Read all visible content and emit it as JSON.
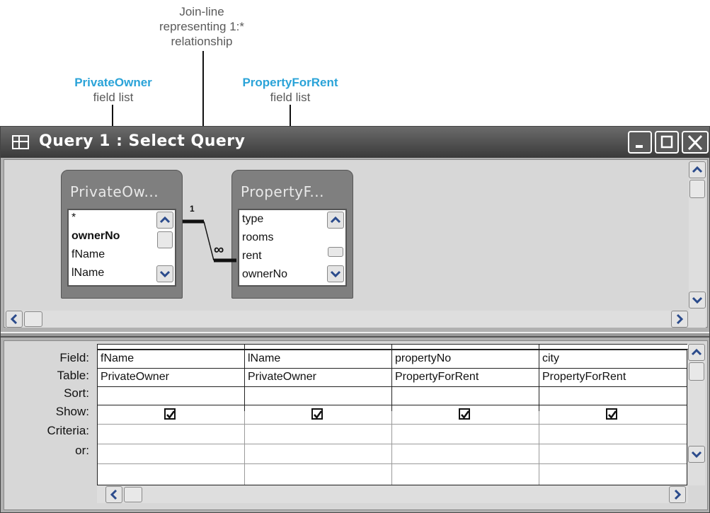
{
  "annotations": {
    "join_line_lines": [
      "Join-line",
      "representing 1:*",
      "relationship"
    ],
    "private_owner_title": "PrivateOwner",
    "private_owner_sub": "field list",
    "property_title": "PropertyForRent",
    "property_sub": "field list"
  },
  "window": {
    "title": "Query 1 : Select Query",
    "icon": "datasheet-icon",
    "buttons": [
      "minimize-icon",
      "maximize-icon",
      "close-icon"
    ]
  },
  "field_lists": [
    {
      "title": "PrivateOw...",
      "items": [
        "*",
        "ownerNo",
        "fName",
        "lName"
      ],
      "bold_item": "ownerNo"
    },
    {
      "title": "PropertyF...",
      "items": [
        "type",
        "rooms",
        "rent",
        "ownerNo"
      ]
    }
  ],
  "relationship": {
    "one_side": "1",
    "many_side": "∞"
  },
  "grid": {
    "row_labels": [
      "Field:",
      "Table:",
      "Sort:",
      "Show:",
      "Criteria:",
      "or:"
    ],
    "columns": [
      {
        "field": "fName",
        "table": "PrivateOwner",
        "show": true
      },
      {
        "field": "lName",
        "table": "PrivateOwner",
        "show": true
      },
      {
        "field": "propertyNo",
        "table": "PropertyForRent",
        "show": true
      },
      {
        "field": "city",
        "table": "PropertyForRent",
        "show": true
      }
    ]
  },
  "colors": {
    "accent": "#2aa3d8",
    "titlebar": "#4a4a4a",
    "panel": "#d7d7d7"
  }
}
